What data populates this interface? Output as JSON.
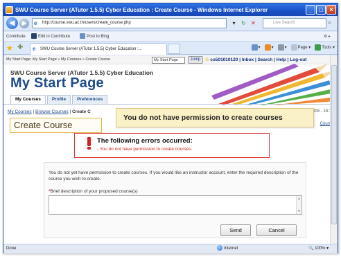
{
  "window": {
    "title": "SWU Course Server (ATutor 1.5.5) Cyber Education : Create Course - Windows Internet Explorer",
    "btn_min": "_",
    "btn_max": "□",
    "btn_close": "×"
  },
  "browser": {
    "url": "http://course.swu.ac.th/users/create_course.php",
    "search_placeholder": "Live Search",
    "links_bar": {
      "contribute": "Contribute",
      "edit": "Edit in Contribute",
      "post": "Post to Blog"
    },
    "tab_label": "SWU Course Server (ATutor 1.5.5) Cyber Education :...",
    "commands": {
      "page": "Page",
      "tools": "Tools"
    },
    "status": {
      "left": "Done",
      "zone": "Internet",
      "zoom": "100%"
    }
  },
  "page": {
    "top_breadcrumb": "My Start Page: My Start Page » My Courses » Create Course",
    "jump_select": "My Start Page",
    "jump_button": "Jump",
    "user_links": "co501010120 | Inbox | Search | Help | Log-out",
    "site_name": "SWU Course Server (ATutor 1.5.5) Cyber Education",
    "title": "My Start Page",
    "tabs": [
      {
        "label": "My Courses",
        "active": true
      },
      {
        "label": "Profile",
        "active": false
      },
      {
        "label": "Preferences",
        "active": false
      }
    ],
    "crumbs": {
      "my_courses": "My Courses",
      "sep": "|",
      "browse_courses": "Browse Courses",
      "create": "Create C"
    },
    "date_text": "008 - 18:11",
    "heading": "Create Course",
    "course_link": "Course",
    "callout": "You do not have permission to create courses",
    "error": {
      "title": "The following errors occurred:",
      "bullet": "-",
      "message": "You do not have permission to create courses."
    },
    "form": {
      "intro": "You do not yet have permission to create courses. If you would like an instructor account, enter the required description of the course you wish to create.",
      "required_mark": "*",
      "label": "Brief description of your proposed course(s)",
      "send": "Send",
      "cancel": "Cancel"
    }
  },
  "colors": {
    "titlebar": "#1a4fc4",
    "brand_blue": "#1e4c8a",
    "error_red": "#d52020",
    "callout_bg": "#fbf1c7"
  },
  "icons": [
    "ie-logo-icon",
    "back-arrow-icon",
    "forward-arrow-icon",
    "refresh-icon",
    "stop-icon",
    "star-icon",
    "add-favorite-icon",
    "home-icon",
    "print-icon",
    "globe-icon",
    "exclamation-icon"
  ]
}
